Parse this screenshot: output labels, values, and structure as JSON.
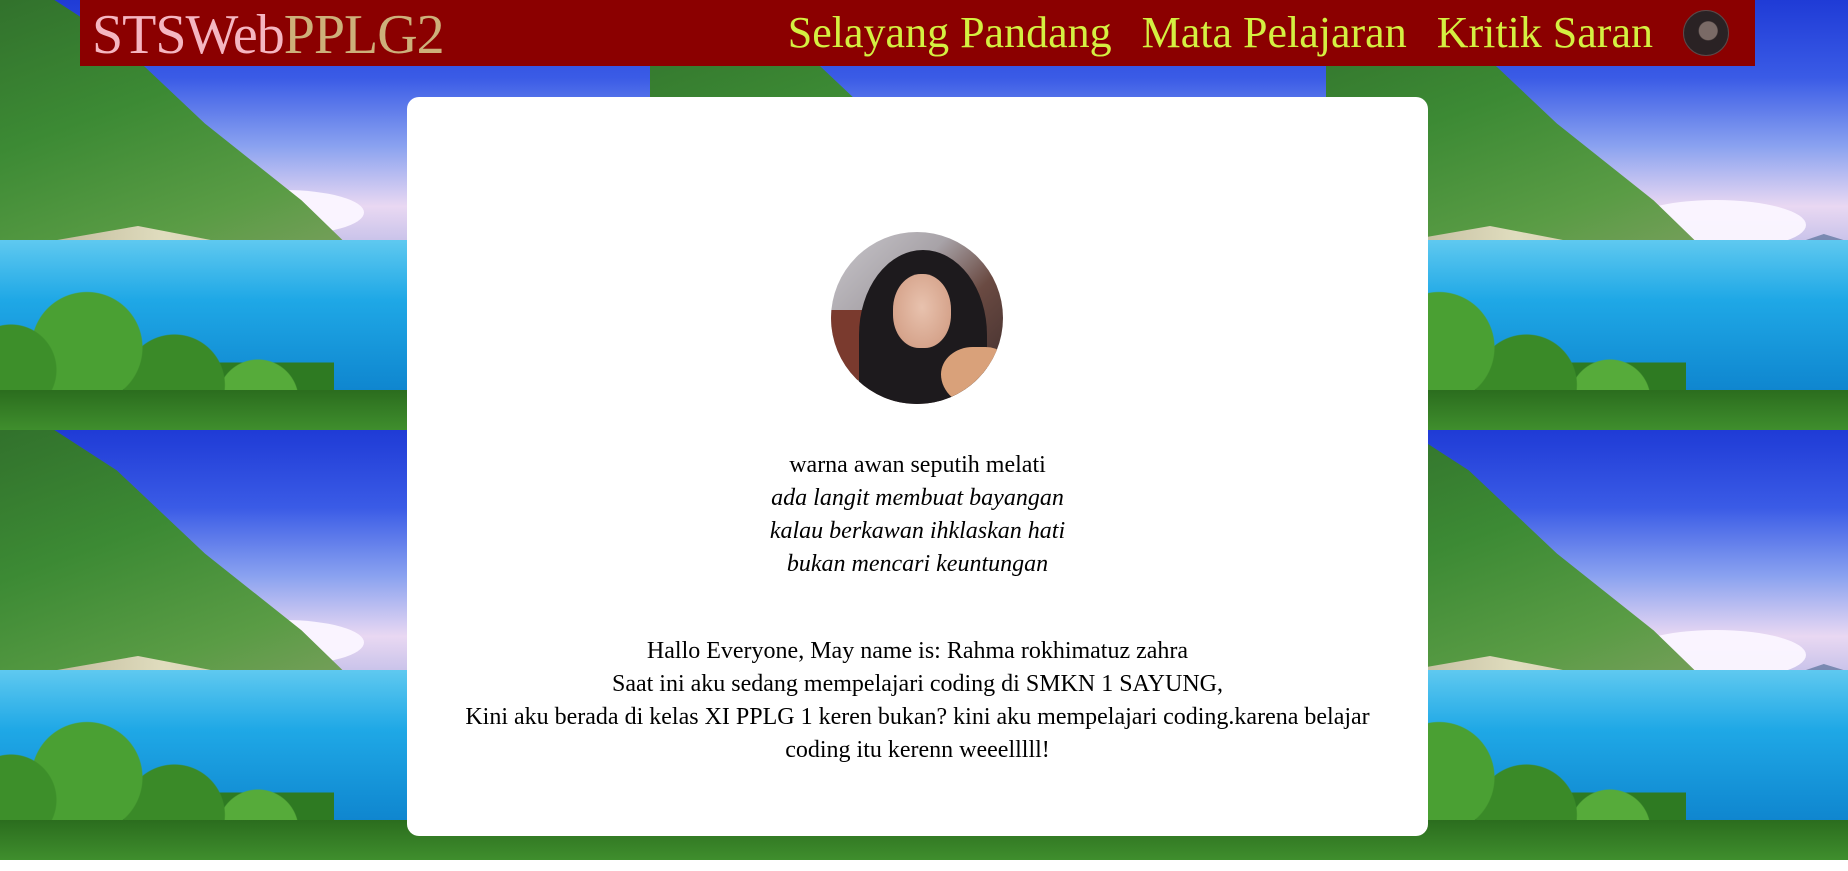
{
  "header": {
    "brand_part1": "STSWeb",
    "brand_part2": "PPLG2",
    "nav": [
      {
        "label": "Selayang Pandang"
      },
      {
        "label": "Mata Pelajaran"
      },
      {
        "label": "Kritik Saran"
      }
    ]
  },
  "poem": [
    "warna awan seputih melati",
    "ada langit membuat bayangan",
    "kalau berkawan ihklaskan hati",
    "bukan mencari keuntungan"
  ],
  "intro": [
    "Hallo Everyone, May name is: Rahma rokhimatuz zahra",
    "Saat ini aku sedang mempelajari coding di SMKN 1 SAYUNG,",
    "Kini aku berada di kelas XI PPLG 1 keren bukan? kini aku mempelajari coding.karena belajar coding itu kerenn weeelllll!"
  ],
  "colors": {
    "header_bg": "#8b0000",
    "brand_part1": "#f5b6c1",
    "brand_part2": "#cdb07a",
    "nav_text": "#d4f041"
  }
}
